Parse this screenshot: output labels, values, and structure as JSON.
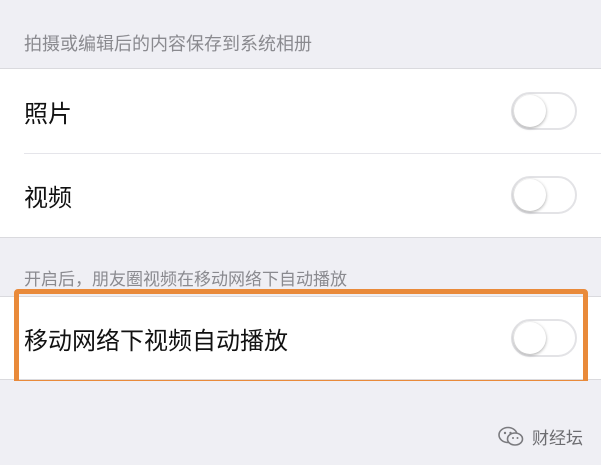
{
  "settings": {
    "save_header": "拍摄或编辑后的内容保存到系统相册",
    "rows": [
      {
        "label": "照片",
        "toggle_on": false
      },
      {
        "label": "视频",
        "toggle_on": false
      }
    ],
    "autoplay_header": "开启后，朋友圈视频在移动网络下自动播放",
    "autoplay_row": {
      "label": "移动网络下视频自动播放",
      "toggle_on": false
    }
  },
  "watermark": {
    "text": "财经坛",
    "icon": "wechat-icon"
  },
  "colors": {
    "highlight": "#e98a3a",
    "background": "#efeff4"
  }
}
